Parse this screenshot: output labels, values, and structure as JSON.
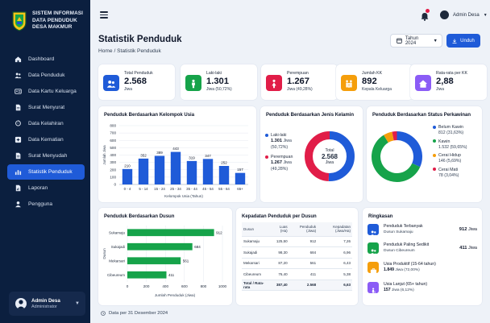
{
  "app": {
    "name_line1": "SISTEM INFORMASI",
    "name_line2": "DATA PENDUDUK",
    "name_line3": "DESA MAKMUR"
  },
  "sidebar": {
    "items": [
      {
        "label": "Dashboard",
        "icon": "home-icon"
      },
      {
        "label": "Data Penduduk",
        "icon": "users-icon"
      },
      {
        "label": "Data Kartu Keluarga",
        "icon": "id-card-icon"
      },
      {
        "label": "Surat Menyurat",
        "icon": "document-icon"
      },
      {
        "label": "Data Kelahiran",
        "icon": "baby-icon"
      },
      {
        "label": "Data Kematian",
        "icon": "plus-box-icon"
      },
      {
        "label": "Surat Menyudah",
        "icon": "document-icon"
      },
      {
        "label": "Statistik Penduduk",
        "icon": "bar-chart-icon",
        "active": true
      },
      {
        "label": "Laporan",
        "icon": "report-icon"
      },
      {
        "label": "Pengguna",
        "icon": "user-icon"
      }
    ],
    "user": {
      "name": "Admin Desa",
      "role": "Administrator"
    }
  },
  "topbar": {
    "user_name": "Admin Desa"
  },
  "header": {
    "title": "Statistik Penduduk",
    "breadcrumb_home": "Home",
    "breadcrumb_sep": "/",
    "breadcrumb_current": "Statistik Penduduk",
    "year_select": "Tahun 2024",
    "export_label": "Unduh"
  },
  "stats": [
    {
      "label": "Total Penduduk",
      "value": "2.568",
      "sub": "Jiwa",
      "color": "#1f5bd8",
      "icon": "users-icon"
    },
    {
      "label": "Laki-laki",
      "value": "1.301",
      "sub": "Jiwa (50,72%)",
      "color": "#16a34a",
      "icon": "male-icon"
    },
    {
      "label": "Perempuan",
      "value": "1.267",
      "sub": "Jiwa (49,28%)",
      "color": "#e11d48",
      "icon": "female-icon"
    },
    {
      "label": "Jumlah KK",
      "value": "892",
      "sub": "Kepala Keluarga",
      "color": "#f59e0b",
      "icon": "family-icon"
    },
    {
      "label": "Rata-rata per KK",
      "value": "2,88",
      "sub": "Jiwa",
      "color": "#8b5cf6",
      "icon": "house-icon"
    }
  ],
  "age_chart": {
    "title": "Penduduk Berdasarkan Kelompok Usia",
    "xlabel": "Kelompok Usia (Tahun)",
    "ylabel": "Jumlah Jiwa"
  },
  "gender_chart": {
    "title": "Penduduk Berdasarkan Jenis Kelamin",
    "center_label": "Total",
    "center_value": "2.568",
    "center_unit": "Jiwa",
    "items": [
      {
        "name": "Laki-laki",
        "value": "1.301",
        "unit": "Jiwa",
        "pct": "(50,72%)",
        "color": "#1f5bd8"
      },
      {
        "name": "Perempuan",
        "value": "1.267",
        "unit": "Jiwa",
        "pct": "(49,28%)",
        "color": "#e11d48"
      }
    ]
  },
  "marital_chart": {
    "title": "Penduduk Berdasarkan Status Perkawinan",
    "items": [
      {
        "name": "Belum Kawin",
        "value": "812",
        "pct": "(31,63%)",
        "color": "#1f5bd8"
      },
      {
        "name": "Kawin",
        "value": "1.532",
        "pct": "(59,65%)",
        "color": "#16a34a"
      },
      {
        "name": "Cerai Hidup",
        "value": "146",
        "pct": "(5,69%)",
        "color": "#f59e0b"
      },
      {
        "name": "Cerai Mati",
        "value": "78",
        "pct": "(3,04%)",
        "color": "#e11d48"
      }
    ]
  },
  "dusun_chart": {
    "title": "Penduduk Berdasarkan Dusun",
    "xlabel": "Jumlah Penduduk (Jiwa)",
    "ylabel": "Dusun"
  },
  "density": {
    "title": "Kepadatan Penduduk per Dusun",
    "headers": [
      "Dusun",
      "Luas (Ha)",
      "Penduduk (Jiwa)",
      "Kepadatan (Jiwa/Ha)"
    ],
    "rows": [
      [
        "Sukamaju",
        "125,50",
        "912",
        "7,26"
      ],
      [
        "Sukajadi",
        "98,30",
        "684",
        "6,96"
      ],
      [
        "Mekarsari",
        "87,20",
        "561",
        "6,43"
      ],
      [
        "Cibeureum",
        "76,40",
        "411",
        "5,38"
      ]
    ],
    "total": [
      "Total / Rata-rata",
      "387,40",
      "2.568",
      "6,63"
    ]
  },
  "summary": {
    "title": "Ringkasan",
    "items": [
      {
        "label": "Penduduk Terbanyak",
        "sub": "Dusun Sukamaju",
        "value": "912",
        "unit": "Jiwa",
        "color": "#1f5bd8",
        "icon": "users-icon"
      },
      {
        "label": "Penduduk Paling Sedikit",
        "sub": "Dusun Cibeureum",
        "value": "411",
        "unit": "Jiwa",
        "color": "#16a34a",
        "icon": "users-icon"
      },
      {
        "label": "Usia Produktif (15-64 tahun)",
        "sub_value": "1.849",
        "sub": "Jiwa (72,00%)",
        "color": "#f59e0b",
        "icon": "briefcase-icon"
      },
      {
        "label": "Usia Lanjut (65+ tahun)",
        "sub_value": "157",
        "sub": "Jiwa (6,12%)",
        "color": "#8b5cf6",
        "icon": "elderly-icon"
      }
    ]
  },
  "footer": {
    "note": "Data per 31 Desember 2024"
  },
  "chart_data": [
    {
      "type": "bar",
      "title": "Penduduk Berdasarkan Kelompok Usia",
      "xlabel": "Kelompok Usia (Tahun)",
      "ylabel": "Jumlah Jiwa",
      "categories": [
        "0 - 4",
        "5 - 14",
        "15 - 24",
        "25 - 34",
        "35 - 44",
        "45 - 54",
        "55 - 64",
        "65+"
      ],
      "values": [
        210,
        352,
        389,
        443,
        319,
        347,
        252,
        157
      ],
      "ylim": [
        0,
        800
      ],
      "yticks": [
        0,
        100,
        200,
        300,
        400,
        500,
        600,
        700,
        800
      ],
      "color": "#1f5bd8"
    },
    {
      "type": "pie",
      "title": "Penduduk Berdasarkan Jenis Kelamin",
      "categories": [
        "Laki-laki",
        "Perempuan"
      ],
      "values": [
        1301,
        1267
      ],
      "colors": [
        "#1f5bd8",
        "#e11d48"
      ]
    },
    {
      "type": "pie",
      "title": "Penduduk Berdasarkan Status Perkawinan",
      "categories": [
        "Belum Kawin",
        "Kawin",
        "Cerai Hidup",
        "Cerai Mati"
      ],
      "values": [
        812,
        1532,
        146,
        78
      ],
      "colors": [
        "#1f5bd8",
        "#16a34a",
        "#f59e0b",
        "#e11d48"
      ]
    },
    {
      "type": "bar",
      "orientation": "horizontal",
      "title": "Penduduk Berdasarkan Dusun",
      "xlabel": "Jumlah Penduduk (Jiwa)",
      "ylabel": "Dusun",
      "categories": [
        "Sukamaju",
        "Sukajadi",
        "Mekarsari",
        "Cibeureum"
      ],
      "values": [
        912,
        684,
        561,
        411
      ],
      "xlim": [
        0,
        1000
      ],
      "xticks": [
        0,
        200,
        400,
        600,
        800,
        1000
      ],
      "color": "#16a34a"
    }
  ]
}
